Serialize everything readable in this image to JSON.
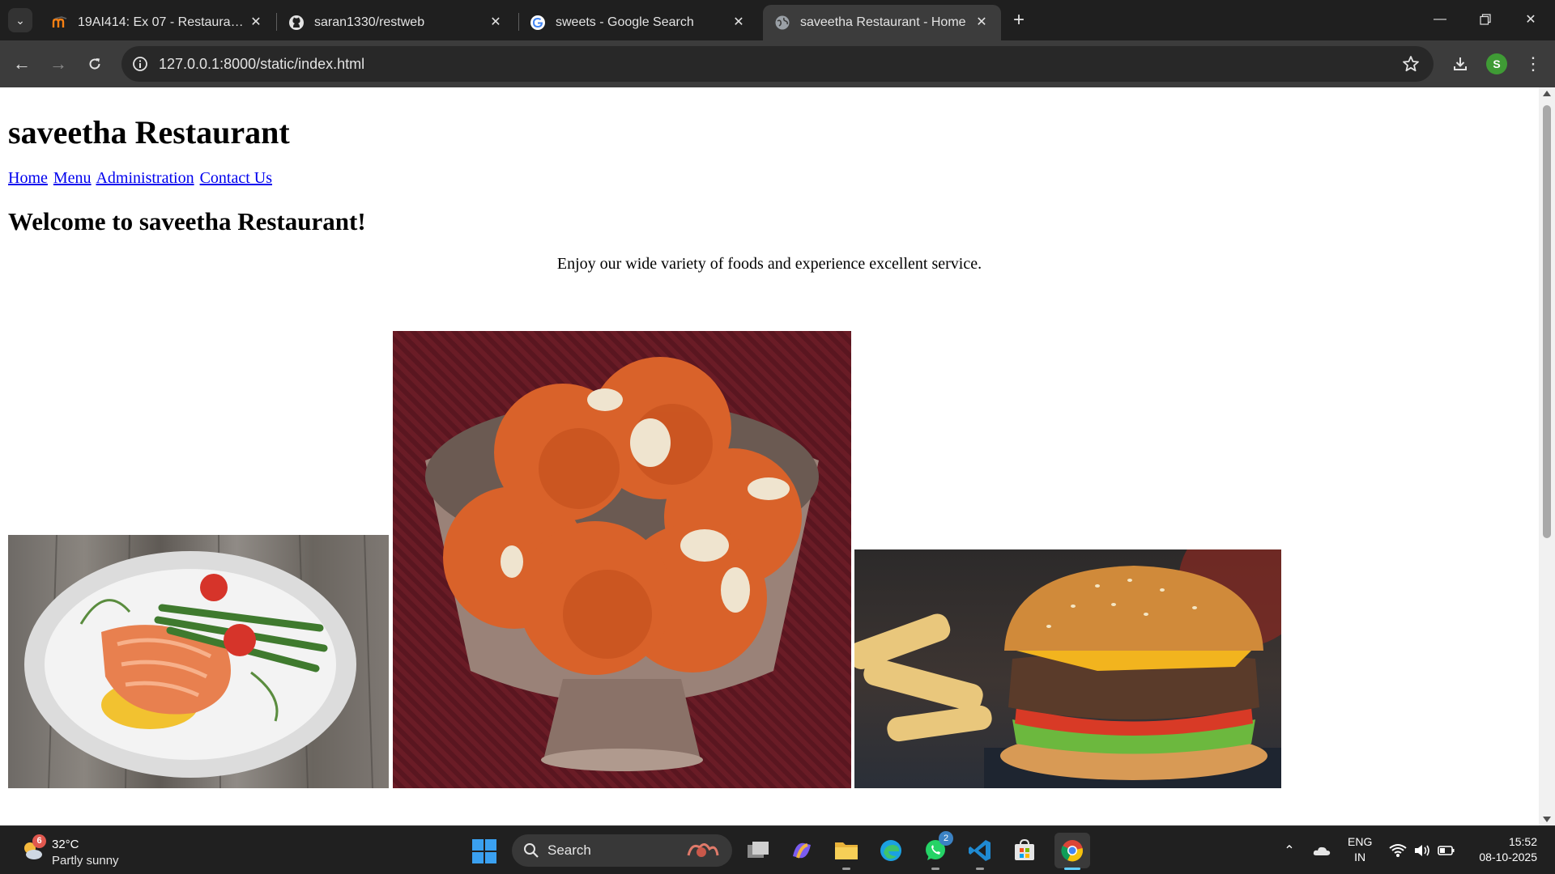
{
  "browser": {
    "tabs": [
      {
        "title": "19AI414: Ex 07 - Restaurant We",
        "favicon": "moodle-icon",
        "active": false
      },
      {
        "title": "saran1330/restweb",
        "favicon": "github-icon",
        "active": false
      },
      {
        "title": "sweets - Google Search",
        "favicon": "google-icon",
        "active": false
      },
      {
        "title": "saveetha Restaurant - Home",
        "favicon": "globe-icon",
        "active": true
      }
    ],
    "url": "127.0.0.1:8000/static/index.html",
    "profile_initial": "S"
  },
  "page": {
    "site_title": "saveetha Restaurant",
    "nav": [
      "Home",
      "Menu",
      "Administration",
      "Contact Us"
    ],
    "welcome_heading": "Welcome to saveetha Restaurant!",
    "tagline": "Enjoy our wide variety of foods and experience excellent service.",
    "images": [
      "salmon-dish-photo",
      "ladoo-sweets-photo",
      "burger-fries-photo"
    ]
  },
  "taskbar": {
    "weather": {
      "temperature": "32°C",
      "condition": "Partly sunny",
      "badge": "6"
    },
    "search_label": "Search",
    "whatsapp_badge": "2",
    "language": {
      "line1": "ENG",
      "line2": "IN"
    },
    "clock": {
      "time": "15:52",
      "date": "08-10-2025"
    }
  },
  "colors": {
    "link": "#0000ee",
    "tab_strip": "#1f1f1f",
    "toolbar": "#3c3c3c",
    "taskbar": "#202020",
    "active_indicator": "#60cdff"
  }
}
